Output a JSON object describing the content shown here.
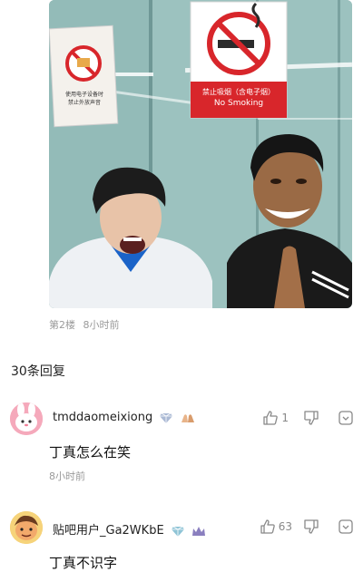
{
  "post": {
    "image": {
      "sign_left": {
        "line1": "使用电子设备时",
        "line2": "禁止外放声音"
      },
      "sign_right": {
        "text_cn": "禁止吸烟（含电子烟）",
        "text_en": "No Smoking"
      }
    },
    "floor": "第2楼",
    "time": "8小时前"
  },
  "replies_count": "30条回复",
  "comments": [
    {
      "username": "tmddaomeixiong",
      "text": "丁真怎么在笑",
      "time": "8小时前",
      "like_count": "1",
      "avatar_color": "#f29bb0"
    },
    {
      "username": "贴吧用户_Ga2WKbE",
      "text": "丁真不识字",
      "like_count": "63",
      "avatar_color": "#f2c15a"
    }
  ],
  "colors": {
    "sign_red": "#d8262b",
    "meta_gray": "#9a9a9a",
    "badge_blue": "#8fa6c8"
  },
  "icons": [
    "thumbs-up-icon",
    "thumbs-down-icon",
    "more-icon",
    "diamond-badge-icon",
    "hands-badge-icon",
    "crown-badge-icon"
  ]
}
